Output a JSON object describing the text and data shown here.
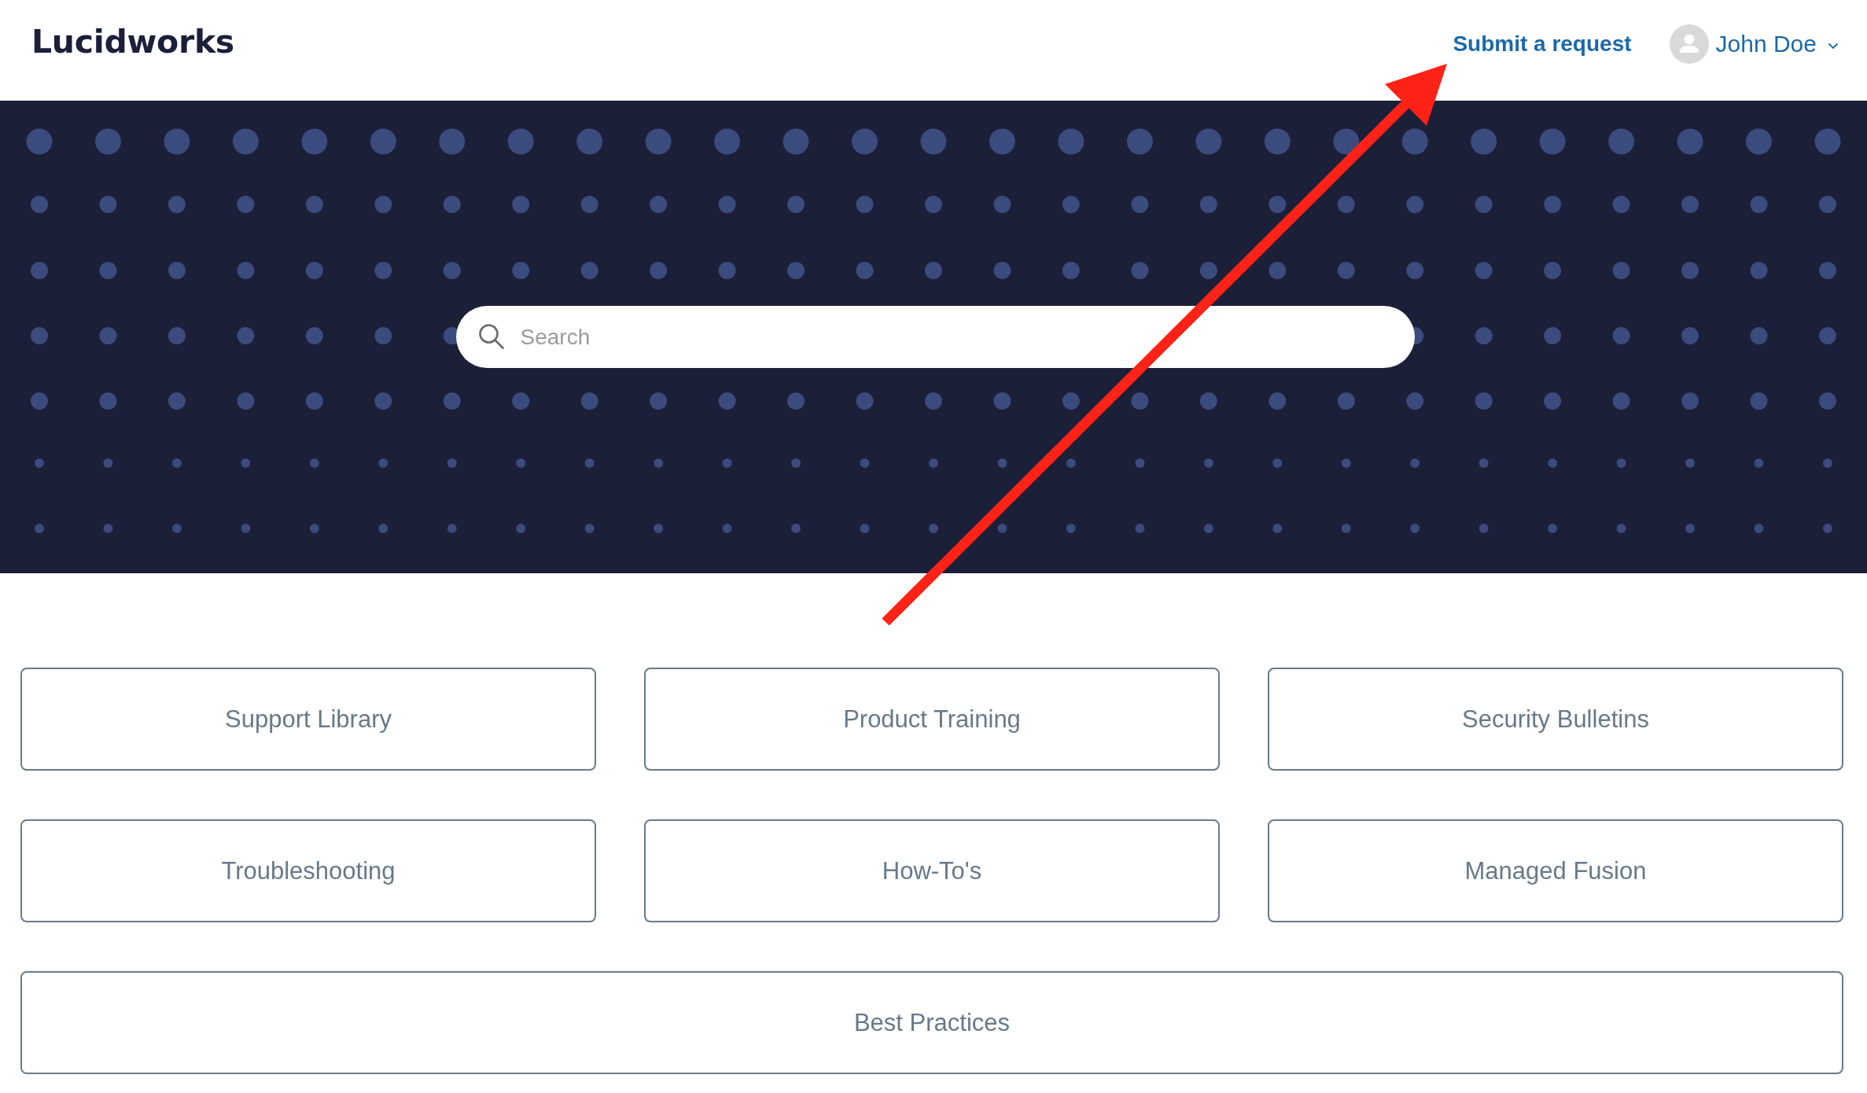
{
  "header": {
    "logo": "Lucidworks",
    "submit_link": "Submit a request",
    "user": {
      "name": "John Doe"
    }
  },
  "hero": {
    "search": {
      "placeholder": "Search"
    }
  },
  "categories": [
    {
      "label": "Support Library"
    },
    {
      "label": "Product Training"
    },
    {
      "label": "Security Bulletins"
    },
    {
      "label": "Troubleshooting"
    },
    {
      "label": "How-To's"
    },
    {
      "label": "Managed Fusion"
    },
    {
      "label": "Best Practices"
    }
  ]
}
